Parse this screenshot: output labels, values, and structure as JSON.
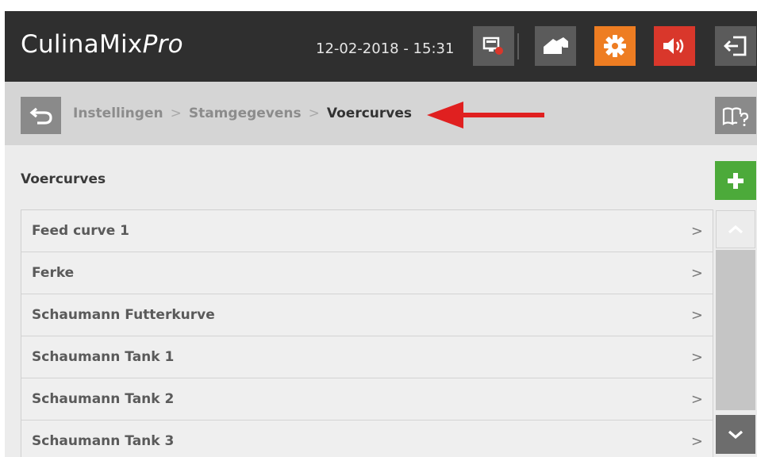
{
  "header": {
    "title_main": "CulinaMix",
    "title_italic": "Pro",
    "datetime": "12-02-2018 - 15:31",
    "icons": {
      "status": "monitor-status-icon",
      "home": "barn-home-icon",
      "settings": "gear-icon",
      "sound": "speaker-icon",
      "logout": "logout-icon"
    },
    "colors": {
      "settings": "#ee7d22",
      "sound": "#d9372b",
      "bar": "#2f2f2f"
    }
  },
  "breadcrumb": {
    "items": [
      "Instellingen",
      "Stamgegevens",
      "Voercurves"
    ],
    "separator": ">"
  },
  "section": {
    "title": "Voercurves",
    "add_color": "#4caa3a"
  },
  "list": {
    "items": [
      "Feed curve 1",
      "Ferke",
      "Schaumann Futterkurve",
      "Schaumann Tank 1",
      "Schaumann Tank 2",
      "Schaumann Tank 3"
    ],
    "chevron": ">"
  }
}
